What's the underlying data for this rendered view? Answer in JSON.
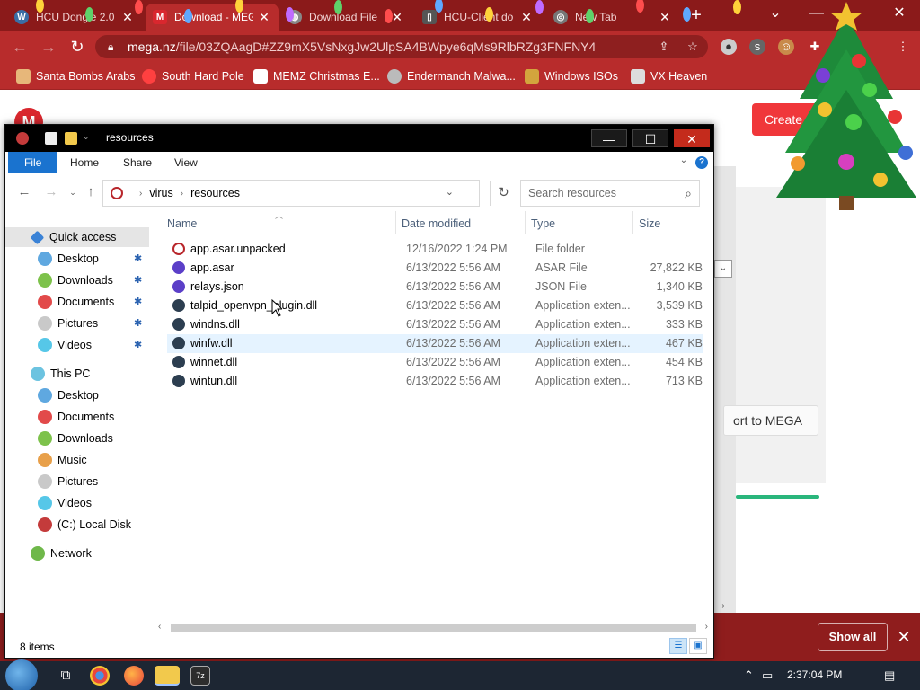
{
  "browser": {
    "tabs": [
      {
        "title": "HCU Dongle 2.0",
        "icon": "wordpress-icon"
      },
      {
        "title": "Download - MEGA",
        "icon": "mega-icon",
        "active": true
      },
      {
        "title": "Download File",
        "icon": "globe-icon"
      },
      {
        "title": "HCU-Client do",
        "icon": "document-icon"
      },
      {
        "title": "New Tab",
        "icon": "chrome-icon"
      }
    ],
    "url_host": "mega.nz",
    "url_path": "/file/03ZQAagD#ZZ9mX5VsNxgJw2UlpSA4BWpye6qMs9RlbRZg3FNFNY4",
    "bookmarks": [
      {
        "label": "Santa Bombs Arabs"
      },
      {
        "label": "South Hard Pole"
      },
      {
        "label": "MEMZ Christmas E..."
      },
      {
        "label": "Endermanch Malwa..."
      },
      {
        "label": "Windows ISOs"
      },
      {
        "label": "VX Heaven"
      }
    ]
  },
  "mega_page": {
    "create_label": "Create",
    "import_label": "ort to MEGA",
    "show_all_label": "Show all"
  },
  "explorer": {
    "title": "resources",
    "ribbon_tabs": [
      "File",
      "Home",
      "Share",
      "View"
    ],
    "path": [
      "virus",
      "resources"
    ],
    "search_placeholder": "Search resources",
    "columns": {
      "name": "Name",
      "date": "Date modified",
      "type": "Type",
      "size": "Size"
    },
    "files": [
      {
        "name": "app.asar.unpacked",
        "date": "12/16/2022 1:24 PM",
        "type": "File folder",
        "size": ""
      },
      {
        "name": "app.asar",
        "date": "6/13/2022 5:56 AM",
        "type": "ASAR File",
        "size": "27,822 KB"
      },
      {
        "name": "relays.json",
        "date": "6/13/2022 5:56 AM",
        "type": "JSON File",
        "size": "1,340 KB"
      },
      {
        "name": "talpid_openvpn_plugin.dll",
        "date": "6/13/2022 5:56 AM",
        "type": "Application exten...",
        "size": "3,539 KB"
      },
      {
        "name": "windns.dll",
        "date": "6/13/2022 5:56 AM",
        "type": "Application exten...",
        "size": "333 KB"
      },
      {
        "name": "winfw.dll",
        "date": "6/13/2022 5:56 AM",
        "type": "Application exten...",
        "size": "467 KB"
      },
      {
        "name": "winnet.dll",
        "date": "6/13/2022 5:56 AM",
        "type": "Application exten...",
        "size": "454 KB"
      },
      {
        "name": "wintun.dll",
        "date": "6/13/2022 5:56 AM",
        "type": "Application exten...",
        "size": "713 KB"
      }
    ],
    "nav": {
      "quick_access": "Quick access",
      "quick_items": [
        "Desktop",
        "Downloads",
        "Documents",
        "Pictures",
        "Videos"
      ],
      "this_pc": "This PC",
      "pc_items": [
        "Desktop",
        "Documents",
        "Downloads",
        "Music",
        "Pictures",
        "Videos",
        "(C:) Local Disk"
      ],
      "network": "Network"
    },
    "status": "8 items"
  },
  "taskbar": {
    "time": "2:37:04 PM"
  },
  "colors": {
    "chrome_dark": "#8b1a1a",
    "chrome_toolbar": "#b82c2c",
    "file_tab": "#1a73cf",
    "mega_red": "#d9272e",
    "hover_row": "#e5f3ff"
  }
}
